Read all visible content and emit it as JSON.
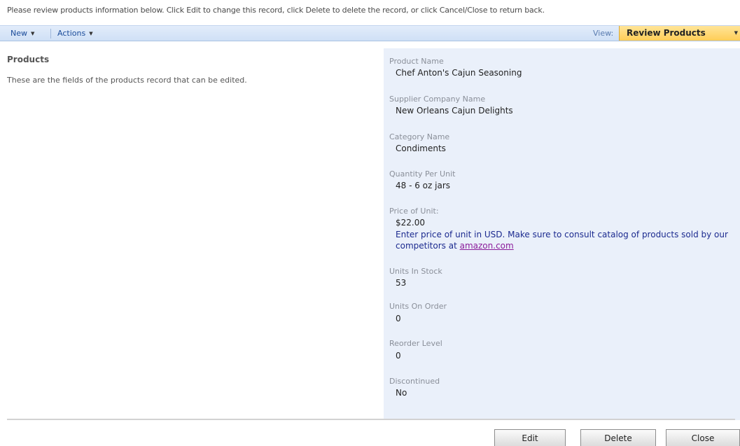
{
  "instructions": "Please review products information below. Click Edit to change this record, click Delete to delete the record, or click Cancel/Close to return back.",
  "toolbar": {
    "new_label": "New",
    "actions_label": "Actions",
    "view_label": "View:",
    "view_value": "Review Products"
  },
  "section": {
    "title": "Products",
    "description": "These are the fields of the products record that can be edited."
  },
  "fields": [
    {
      "label": "Product Name",
      "value": "Chef Anton's Cajun Seasoning"
    },
    {
      "label": "Supplier Company Name",
      "value": "New Orleans Cajun Delights"
    },
    {
      "label": "Category Name",
      "value": "Condiments"
    },
    {
      "label": "Quantity Per Unit",
      "value": "48 - 6 oz jars"
    },
    {
      "label": "Price of Unit:",
      "value": "$22.00",
      "hint": "Enter price of unit in USD. Make sure to consult catalog of products sold by our competitors at",
      "hint_link": "amazon.com"
    },
    {
      "label": "Units In Stock",
      "value": "53"
    },
    {
      "label": "Units On Order",
      "value": "0"
    },
    {
      "label": "Reorder Level",
      "value": "0"
    },
    {
      "label": "Discontinued",
      "value": "No"
    }
  ],
  "buttons": {
    "edit": "Edit",
    "delete": "Delete",
    "close": "Close"
  }
}
